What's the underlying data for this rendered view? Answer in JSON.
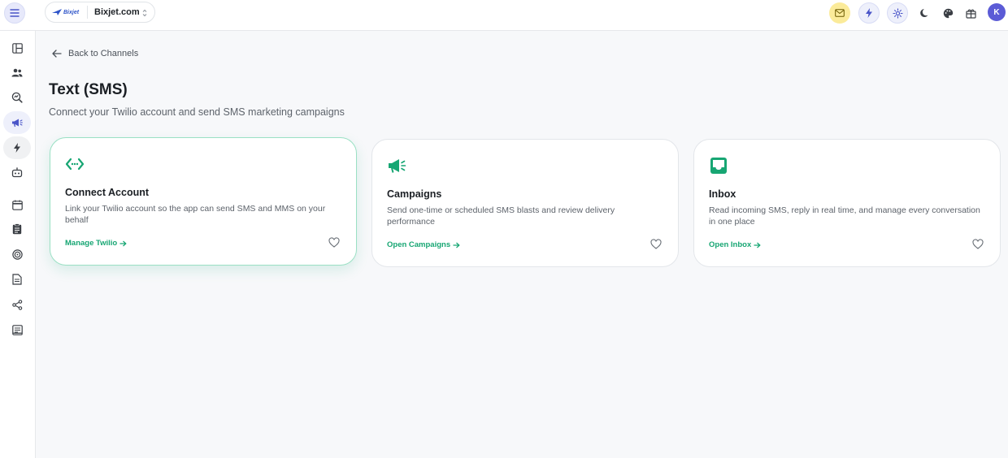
{
  "header": {
    "workspace": {
      "logo_text": "Bixjet",
      "name": "Bixjet.com"
    },
    "avatar_initial": "K"
  },
  "back_link": {
    "label": "Back to Channels"
  },
  "page": {
    "title": "Text (SMS)",
    "subtitle": "Connect your Twilio account and send SMS marketing campaigns"
  },
  "cards": [
    {
      "icon": "code-connect-icon",
      "title": "Connect Account",
      "description": "Link your Twilio account so the app can send SMS and MMS on your behalf",
      "link": "Manage Twilio"
    },
    {
      "icon": "megaphone-icon",
      "title": "Campaigns",
      "description": "Send one-time or scheduled SMS blasts and review delivery performance",
      "link": "Open Campaigns"
    },
    {
      "icon": "inbox-icon",
      "title": "Inbox",
      "description": "Read incoming SMS, reply in real time, and manage every conversation in one place",
      "link": "Open Inbox"
    }
  ],
  "colors": {
    "accent": "#17a673",
    "brand": "#5b5bd6",
    "mail_badge": "#fbeb9a"
  },
  "sidebar_icons": [
    "layout-icon",
    "users-icon",
    "analytics-icon",
    "megaphone-icon",
    "lightning-icon",
    "robot-icon",
    "calendar-icon",
    "clipboard-icon",
    "target-icon",
    "document-icon",
    "share-icon",
    "report-icon"
  ]
}
